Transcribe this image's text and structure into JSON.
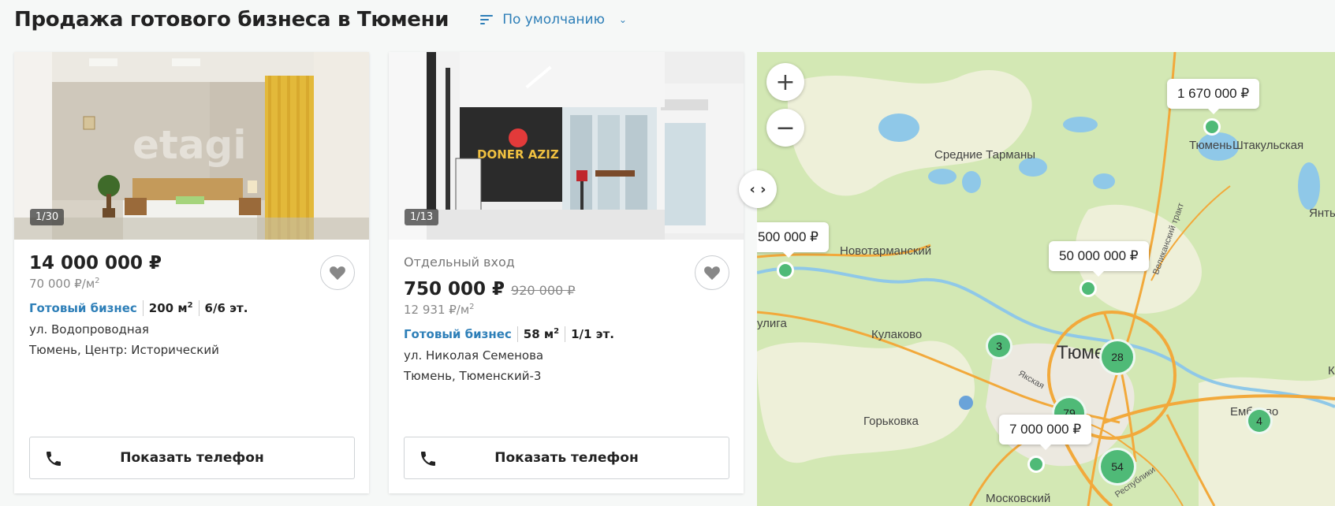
{
  "header": {
    "title": "Продажа готового бизнеса в Тюмени",
    "sort_label": "По умолчанию"
  },
  "listings": [
    {
      "photo_counter": "1/30",
      "price": "14 000 000 ₽",
      "price_per_m": "70 000 ₽/м",
      "category": "Готовый бизнес",
      "area": "200 м",
      "floor": "6/6 эт.",
      "street": "ул. Водопроводная",
      "district": "Тюмень, Центр: Исторический",
      "phone_label": "Показать телефон"
    },
    {
      "photo_counter": "1/13",
      "feature": "Отдельный вход",
      "price": "750 000 ₽",
      "old_price": "920 000 ₽",
      "price_per_m": "12 931 ₽/м",
      "category": "Готовый бизнес",
      "area": "58 м",
      "floor": "1/1 эт.",
      "street": "ул. Николая Семенова",
      "district": "Тюмень, Тюменский-3",
      "phone_label": "Показать телефон"
    }
  ],
  "superscript": "2",
  "watermark": "etagi",
  "signboard": "DONER AZIZ",
  "map": {
    "zoom_in": "+",
    "zoom_out": "−",
    "toggle": "‹ ›",
    "price_labels": [
      "1 670 000 ₽",
      "500 000 ₽",
      "50 000 000 ₽",
      "7 000 000 ₽"
    ],
    "clusters": [
      "3",
      "28",
      "79",
      "4",
      "54"
    ],
    "places": [
      "Средние Тарманы",
      "Тюмень",
      "Штакульская",
      "Новотарманский",
      "Кулаково",
      "Тюмен",
      "Горьковка",
      "Ембаево",
      "Московский",
      "улига",
      "Янть",
      "К"
    ],
    "roads": [
      "Великанский тракт",
      "Якская",
      "Республики"
    ],
    "colors": {
      "accent": "#2e7fb8",
      "marker": "#4fba77",
      "forest": "#c9e3a6",
      "water": "#8fc8e8",
      "road": "#f2a93b"
    }
  }
}
